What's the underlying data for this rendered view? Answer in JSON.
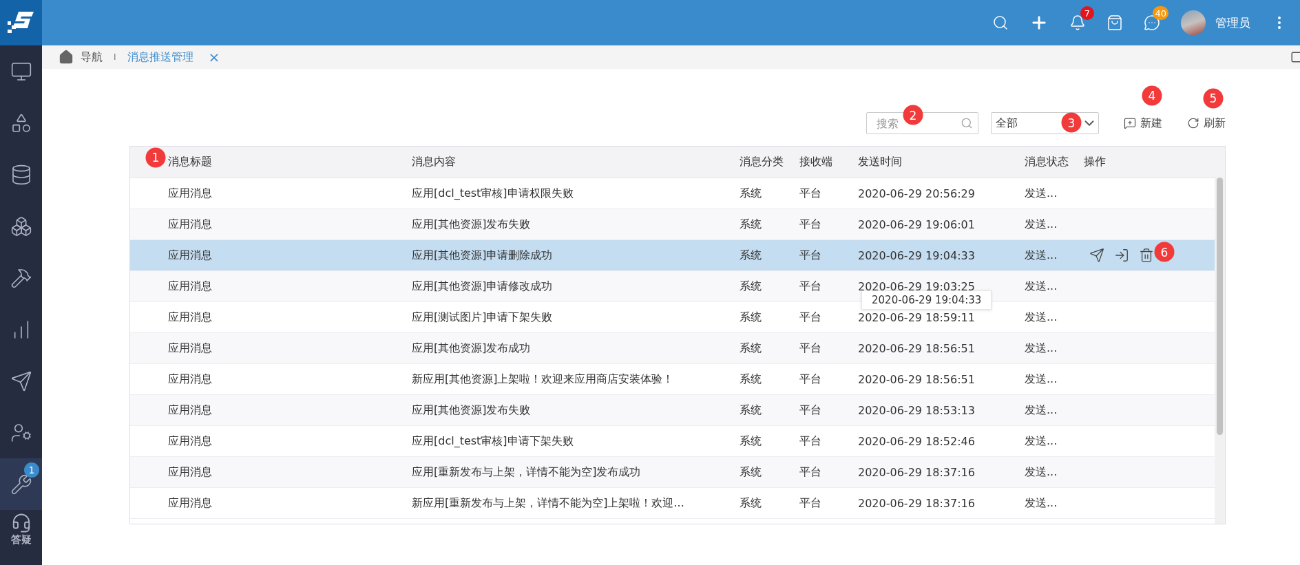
{
  "header": {
    "user": "管理员",
    "notification_badge": "7",
    "message_badge": "40"
  },
  "sidebar": {
    "items": [
      {
        "kind": "monitor",
        "selected": false
      },
      {
        "kind": "shapes",
        "selected": false
      },
      {
        "kind": "database",
        "selected": false
      },
      {
        "kind": "boxes",
        "selected": false
      },
      {
        "kind": "tool",
        "selected": false
      },
      {
        "kind": "chart",
        "selected": false
      },
      {
        "kind": "send",
        "selected": false
      },
      {
        "kind": "user",
        "selected": false
      },
      {
        "kind": "wrench",
        "selected": true,
        "badge": "1"
      }
    ],
    "help": {
      "label": "答疑"
    }
  },
  "breadcrumb": {
    "home": "导航",
    "separator": "I",
    "tab": "消息推送管理",
    "close": "×"
  },
  "toolbar": {
    "search": {
      "placeholder": "搜索",
      "marker": "2"
    },
    "filter": {
      "value": "全部",
      "marker": "3"
    },
    "buttons": [
      {
        "kind": "new",
        "label": "新建",
        "marker": "4"
      },
      {
        "kind": "refresh",
        "label": "刷新",
        "marker": "5"
      }
    ]
  },
  "table": {
    "columns": [
      {
        "label": "消息标题",
        "marker": "1"
      },
      {
        "label": "消息内容"
      },
      {
        "label": "消息分类"
      },
      {
        "label": "接收端"
      },
      {
        "label": "发送时间"
      },
      {
        "label": "消息状态"
      },
      {
        "label": "操作"
      }
    ],
    "rows": [
      {
        "selected": false,
        "cells": [
          "应用消息",
          "应用[dcl_test审核]申请权限失败",
          "系统",
          "平台",
          "2020-06-29 20:56:29",
          "发送..."
        ]
      },
      {
        "selected": false,
        "cells": [
          "应用消息",
          "应用[其他资源]发布失败",
          "系统",
          "平台",
          "2020-06-29 19:06:01",
          "发送..."
        ]
      },
      {
        "selected": true,
        "cells": [
          "应用消息",
          "应用[其他资源]申请删除成功",
          "系统",
          "平台",
          "2020-06-29 19:04:33",
          "发送..."
        ],
        "actions_marker": "6",
        "tooltip": "2020-06-29 19:04:33"
      },
      {
        "selected": false,
        "cells": [
          "应用消息",
          "应用[其他资源]申请修改成功",
          "系统",
          "平台",
          "2020-06-29 19:03:25",
          "发送..."
        ]
      },
      {
        "selected": false,
        "cells": [
          "应用消息",
          "应用[测试图片]申请下架失败",
          "系统",
          "平台",
          "2020-06-29 18:59:11",
          "发送..."
        ]
      },
      {
        "selected": false,
        "cells": [
          "应用消息",
          "应用[其他资源]发布成功",
          "系统",
          "平台",
          "2020-06-29 18:56:51",
          "发送..."
        ]
      },
      {
        "selected": false,
        "cells": [
          "应用消息",
          "新应用[其他资源]上架啦！欢迎来应用商店安装体验！",
          "系统",
          "平台",
          "2020-06-29 18:56:51",
          "发送..."
        ]
      },
      {
        "selected": false,
        "cells": [
          "应用消息",
          "应用[其他资源]发布失败",
          "系统",
          "平台",
          "2020-06-29 18:53:13",
          "发送..."
        ]
      },
      {
        "selected": false,
        "cells": [
          "应用消息",
          "应用[dcl_test审核]申请下架失败",
          "系统",
          "平台",
          "2020-06-29 18:52:46",
          "发送..."
        ]
      },
      {
        "selected": false,
        "cells": [
          "应用消息",
          "应用[重新发布与上架，详情不能为空]发布成功",
          "系统",
          "平台",
          "2020-06-29 18:37:16",
          "发送..."
        ]
      },
      {
        "selected": false,
        "cells": [
          "应用消息",
          "新应用[重新发布与上架，详情不能为空]上架啦！欢迎...",
          "系统",
          "平台",
          "2020-06-29 18:37:16",
          "发送..."
        ]
      }
    ]
  }
}
